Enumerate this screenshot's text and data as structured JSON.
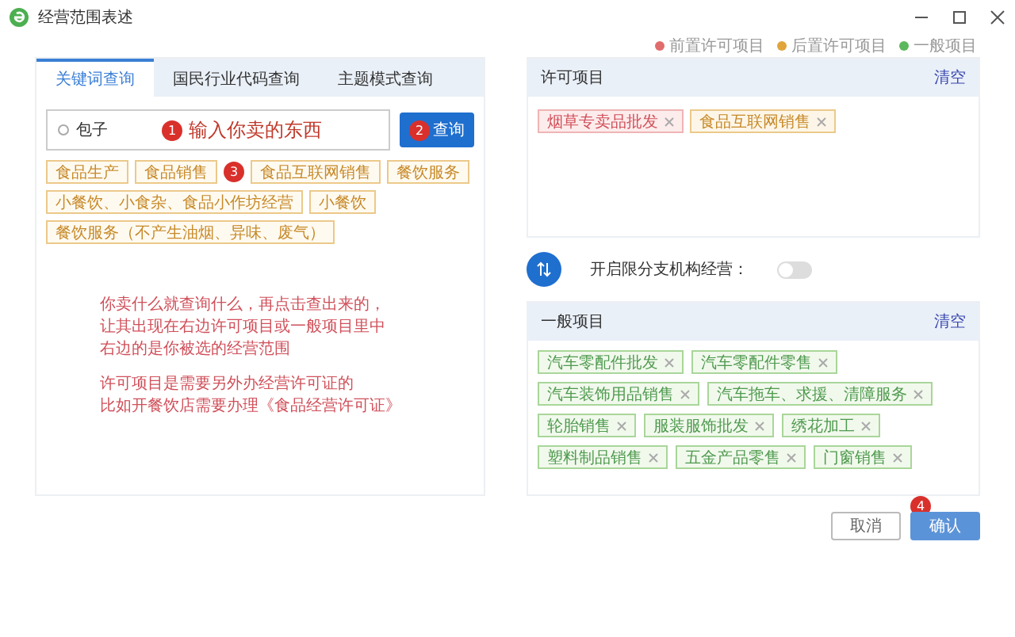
{
  "window": {
    "title": "经营范围表述"
  },
  "legend": [
    {
      "label": "前置许可项目",
      "color": "#e06c6c"
    },
    {
      "label": "后置许可项目",
      "color": "#e0a43a"
    },
    {
      "label": "一般项目",
      "color": "#5cb85c"
    }
  ],
  "tabs": [
    {
      "label": "关键词查询",
      "selected": true
    },
    {
      "label": "国民行业代码查询",
      "selected": false
    },
    {
      "label": "主题模式查询",
      "selected": false
    }
  ],
  "search": {
    "value": "包子",
    "badge": "1",
    "note": "输入你卖的东西",
    "button": "查询",
    "button_badge": "2"
  },
  "results": [
    "食品生产",
    "食品销售",
    "食品互联网销售",
    "餐饮服务",
    "小餐饮、小食杂、食品小作坊经营",
    "小餐饮",
    "餐饮服务（不产生油烟、异味、废气）"
  ],
  "results_badge": "3",
  "notes": [
    [
      "你卖什么就查询什么，再点击查出来的，",
      "让其出现在右边许可项目或一般项目里中",
      "右边的是你被选的经营范围"
    ],
    [
      "许可项目是需要另外办经营许可证的",
      "比如开餐饮店需要办理《食品经营许可证》"
    ]
  ],
  "licensed": {
    "title": "许可项目",
    "clear": "清空",
    "items": [
      {
        "label": "烟草专卖品批发",
        "kind": "front"
      },
      {
        "label": "食品互联网销售",
        "kind": "back"
      }
    ]
  },
  "toggle": {
    "label": "开启限分支机构经营：",
    "on": false
  },
  "general": {
    "title": "一般项目",
    "clear": "清空",
    "items": [
      {
        "label": "汽车零配件批发",
        "kind": "general"
      },
      {
        "label": "汽车零配件零售",
        "kind": "general"
      },
      {
        "label": "汽车装饰用品销售",
        "kind": "general"
      },
      {
        "label": "汽车拖车、求援、清障服务",
        "kind": "general"
      },
      {
        "label": "轮胎销售",
        "kind": "general"
      },
      {
        "label": "服装服饰批发",
        "kind": "general"
      },
      {
        "label": "绣花加工",
        "kind": "general"
      },
      {
        "label": "塑料制品销售",
        "kind": "general"
      },
      {
        "label": "五金产品零售",
        "kind": "general"
      },
      {
        "label": "门窗销售",
        "kind": "general"
      }
    ]
  },
  "buttons": [
    {
      "label": "取消",
      "kind": "secondary"
    },
    {
      "label": "确认",
      "kind": "primary",
      "badge": "4"
    }
  ]
}
